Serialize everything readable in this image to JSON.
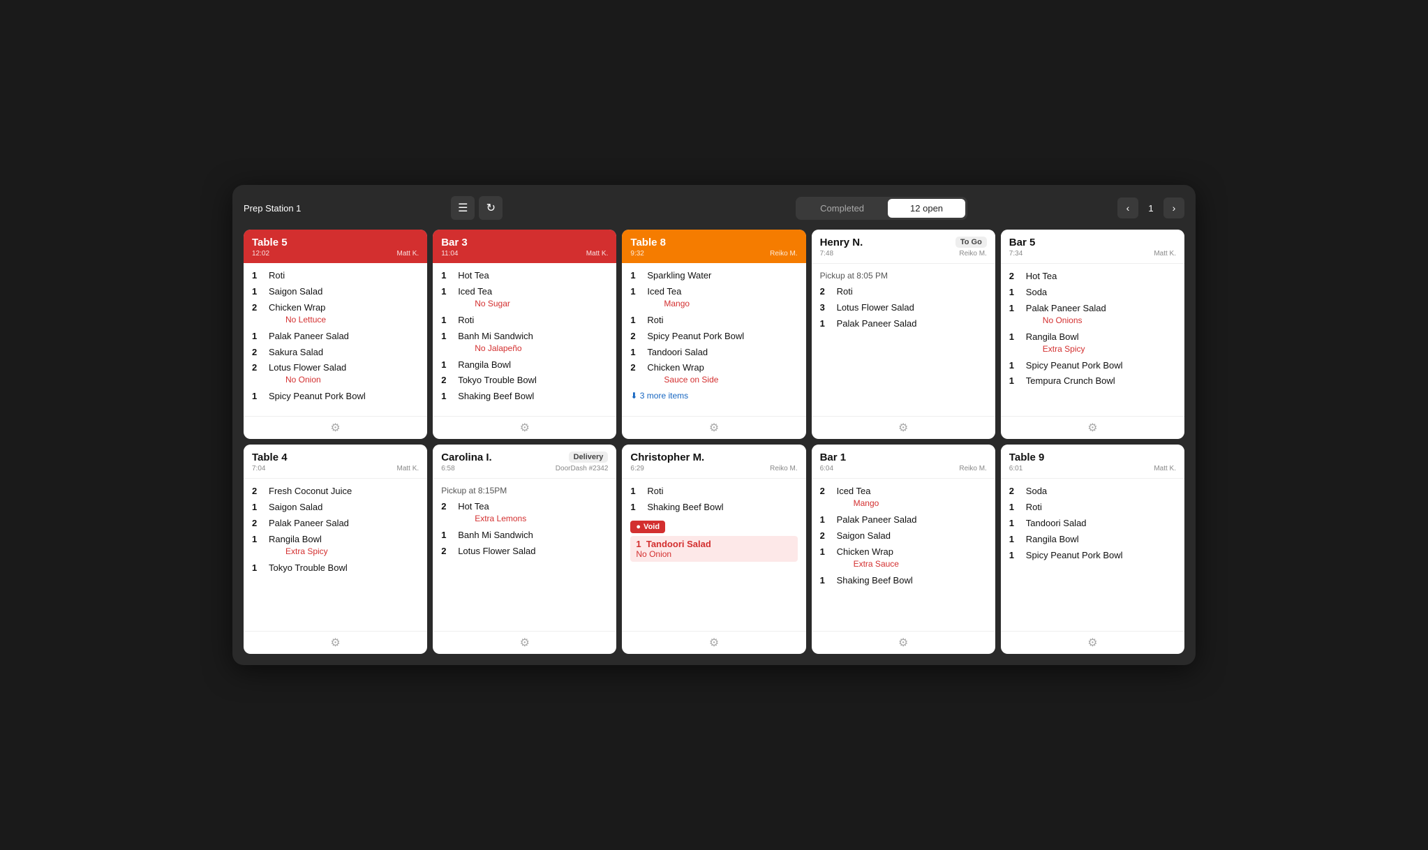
{
  "app": {
    "station": "Prep Station 1",
    "tabs": [
      {
        "label": "Completed",
        "active": false
      },
      {
        "label": "12 open",
        "active": true
      }
    ],
    "page": "1"
  },
  "cards": [
    {
      "id": "table5",
      "title": "Table 5",
      "time": "12:02",
      "staff": "Matt K.",
      "headerStyle": "red",
      "items": [
        {
          "qty": "1",
          "name": "Roti"
        },
        {
          "qty": "1",
          "name": "Saigon Salad"
        },
        {
          "qty": "2",
          "name": "Chicken Wrap",
          "mod": "No Lettuce"
        },
        {
          "qty": "1",
          "name": "Palak Paneer Salad"
        },
        {
          "qty": "2",
          "name": "Sakura Salad"
        },
        {
          "qty": "2",
          "name": "Lotus Flower Salad",
          "mod": "No Onion"
        },
        {
          "qty": "1",
          "name": "Spicy Peanut Pork Bowl"
        }
      ]
    },
    {
      "id": "bar3",
      "title": "Bar 3",
      "time": "11:04",
      "staff": "Matt K.",
      "headerStyle": "red",
      "items": [
        {
          "qty": "1",
          "name": "Hot Tea"
        },
        {
          "qty": "1",
          "name": "Iced Tea",
          "mod": "No Sugar"
        },
        {
          "qty": "1",
          "name": "Roti"
        },
        {
          "qty": "1",
          "name": "Banh Mi Sandwich",
          "mod": "No Jalapeño"
        },
        {
          "qty": "1",
          "name": "Rangila Bowl"
        },
        {
          "qty": "2",
          "name": "Tokyo Trouble Bowl"
        },
        {
          "qty": "1",
          "name": "Shaking Beef Bowl"
        }
      ]
    },
    {
      "id": "table8",
      "title": "Table 8",
      "time": "9:32",
      "staff": "Reiko M.",
      "headerStyle": "orange",
      "items": [
        {
          "qty": "1",
          "name": "Sparkling Water"
        },
        {
          "qty": "1",
          "name": "Iced Tea",
          "mod": "Mango"
        },
        {
          "qty": "1",
          "name": "Roti"
        },
        {
          "qty": "2",
          "name": "Spicy Peanut Pork Bowl"
        },
        {
          "qty": "1",
          "name": "Tandoori Salad"
        },
        {
          "qty": "2",
          "name": "Chicken Wrap",
          "mod": "Sauce on Side"
        }
      ],
      "moreItems": "3 more items"
    },
    {
      "id": "henry-n",
      "title": "Henry N.",
      "badge": "To Go",
      "time": "7:48",
      "staff": "Reiko M.",
      "headerStyle": "white",
      "pickup": "Pickup at 8:05 PM",
      "items": [
        {
          "qty": "2",
          "name": "Roti"
        },
        {
          "qty": "3",
          "name": "Lotus Flower Salad"
        },
        {
          "qty": "1",
          "name": "Palak Paneer Salad"
        }
      ]
    },
    {
      "id": "bar5",
      "title": "Bar 5",
      "time": "7:34",
      "staff": "Matt K.",
      "headerStyle": "white",
      "items": [
        {
          "qty": "2",
          "name": "Hot Tea"
        },
        {
          "qty": "1",
          "name": "Soda"
        },
        {
          "qty": "1",
          "name": "Palak Paneer Salad",
          "mod": "No Onions"
        },
        {
          "qty": "1",
          "name": "Rangila Bowl",
          "mod": "Extra Spicy"
        },
        {
          "qty": "1",
          "name": "Spicy Peanut Pork Bowl"
        },
        {
          "qty": "1",
          "name": "Tempura Crunch Bowl"
        }
      ]
    },
    {
      "id": "table4",
      "title": "Table 4",
      "time": "7:04",
      "staff": "Matt K.",
      "headerStyle": "white",
      "items": [
        {
          "qty": "2",
          "name": "Fresh Coconut Juice"
        },
        {
          "qty": "1",
          "name": "Saigon Salad"
        },
        {
          "qty": "2",
          "name": "Palak Paneer Salad"
        },
        {
          "qty": "1",
          "name": "Rangila Bowl",
          "mod": "Extra Spicy"
        },
        {
          "qty": "1",
          "name": "Tokyo Trouble Bowl"
        }
      ]
    },
    {
      "id": "carolina",
      "title": "Carolina I.",
      "badge": "Delivery",
      "badgeSub": "DoorDash #2342",
      "time": "6:58",
      "staff": "DoorDash #2342",
      "headerStyle": "white",
      "pickup": "Pickup at 8:15PM",
      "items": [
        {
          "qty": "2",
          "name": "Hot Tea",
          "mod": "Extra Lemons"
        },
        {
          "qty": "1",
          "name": "Banh Mi Sandwich"
        },
        {
          "qty": "2",
          "name": "Lotus Flower Salad"
        }
      ]
    },
    {
      "id": "christopher",
      "title": "Christopher M.",
      "time": "6:29",
      "staff": "Reiko M.",
      "headerStyle": "white",
      "items": [
        {
          "qty": "1",
          "name": "Roti"
        },
        {
          "qty": "1",
          "name": "Shaking Beef Bowl"
        }
      ],
      "voidItem": {
        "name": "Tandoori Salad",
        "mod": "No Onion"
      }
    },
    {
      "id": "bar1",
      "title": "Bar 1",
      "time": "6:04",
      "staff": "Reiko M.",
      "headerStyle": "white",
      "items": [
        {
          "qty": "2",
          "name": "Iced Tea",
          "mod": "Mango"
        },
        {
          "qty": "1",
          "name": "Palak Paneer Salad"
        },
        {
          "qty": "2",
          "name": "Saigon Salad"
        },
        {
          "qty": "1",
          "name": "Chicken Wrap",
          "mod": "Extra Sauce"
        },
        {
          "qty": "1",
          "name": "Shaking Beef Bowl"
        }
      ]
    },
    {
      "id": "table9",
      "title": "Table 9",
      "time": "6:01",
      "staff": "Matt K.",
      "headerStyle": "white",
      "items": [
        {
          "qty": "2",
          "name": "Soda"
        },
        {
          "qty": "1",
          "name": "Roti"
        },
        {
          "qty": "1",
          "name": "Tandoori Salad"
        },
        {
          "qty": "1",
          "name": "Rangila Bowl"
        },
        {
          "qty": "1",
          "name": "Spicy Peanut Pork Bowl"
        }
      ]
    }
  ]
}
